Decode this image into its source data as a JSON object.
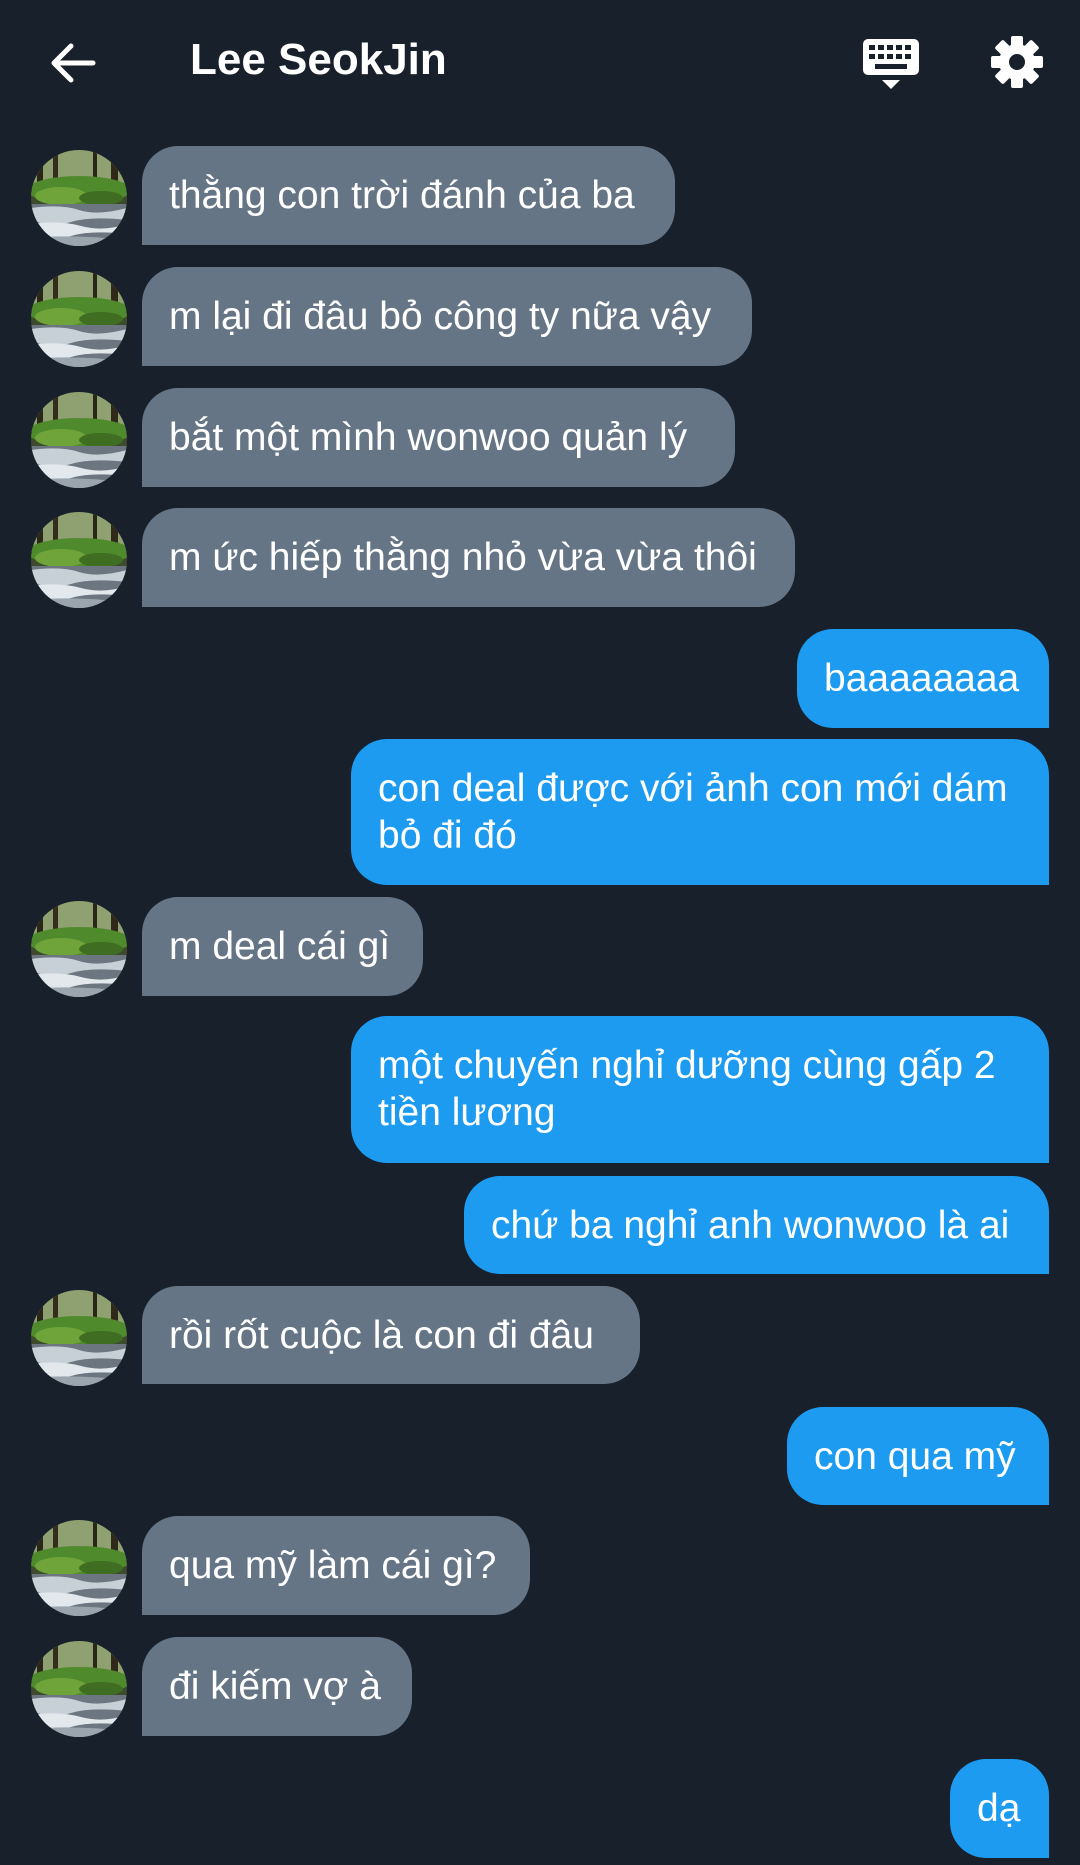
{
  "header": {
    "contact_name": "Lee SeokJin",
    "back_icon": "arrow-left-icon",
    "keyboard_icon": "keyboard-icon",
    "settings_icon": "gear-icon"
  },
  "colors": {
    "background": "#17202b",
    "incoming_bubble": "#657585",
    "outgoing_bubble": "#1d9bf0",
    "text": "#ffffff"
  },
  "messages": [
    {
      "direction": "in",
      "text": "thằng con trời đánh của ba"
    },
    {
      "direction": "in",
      "text": "m lại đi đâu bỏ công ty nữa vậy"
    },
    {
      "direction": "in",
      "text": "bắt một mình wonwoo quản lý"
    },
    {
      "direction": "in",
      "text": "m ức hiếp thằng nhỏ vừa vừa thôi"
    },
    {
      "direction": "out",
      "text": "baaaaaaaa"
    },
    {
      "direction": "out",
      "text": "con deal được với ảnh con mới dám bỏ đi đó"
    },
    {
      "direction": "in",
      "text": "m deal cái gì"
    },
    {
      "direction": "out",
      "text": "một chuyến nghỉ dưỡng cùng gấp 2 tiền lương"
    },
    {
      "direction": "out",
      "text": "chứ ba nghỉ anh wonwoo là ai"
    },
    {
      "direction": "in",
      "text": "rồi rốt cuộc là con đi đâu"
    },
    {
      "direction": "out",
      "text": "con qua mỹ"
    },
    {
      "direction": "in",
      "text": "qua mỹ làm cái gì?"
    },
    {
      "direction": "in",
      "text": "đi kiếm vợ à"
    },
    {
      "direction": "out",
      "text": "dạ"
    }
  ]
}
